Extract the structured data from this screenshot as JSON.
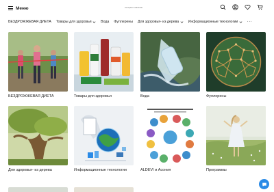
{
  "header": {
    "menu_label": "Меню",
    "site_name": "интернет-магазин",
    "icons": [
      "search-icon",
      "user-icon",
      "heart-icon",
      "cart-icon"
    ]
  },
  "nav": {
    "items": [
      {
        "label": "БЕЗДРОЖЖЕВАЯ ДИЕТА",
        "has_dropdown": false
      },
      {
        "label": "Товары для здоровья",
        "has_dropdown": true
      },
      {
        "label": "Вода",
        "has_dropdown": false
      },
      {
        "label": "Фуллерены",
        "has_dropdown": false
      },
      {
        "label": "Для здоровья- из дерева",
        "has_dropdown": true
      },
      {
        "label": "Информационные технологии",
        "has_dropdown": true
      }
    ],
    "more": "···"
  },
  "categories": [
    {
      "title": "БЕЗДРОЖЖЕВАЯ ДИЕТА"
    },
    {
      "title": "Товары для здоровья"
    },
    {
      "title": "Вода"
    },
    {
      "title": "Фуллерены"
    },
    {
      "title": "Для здоровья- из дерева"
    },
    {
      "title": "Информационные технологии"
    },
    {
      "title": "ALDEVI и Асония"
    },
    {
      "title": "Программы"
    }
  ],
  "colors": {
    "accent": "#2a8ae6",
    "text": "#222222"
  }
}
